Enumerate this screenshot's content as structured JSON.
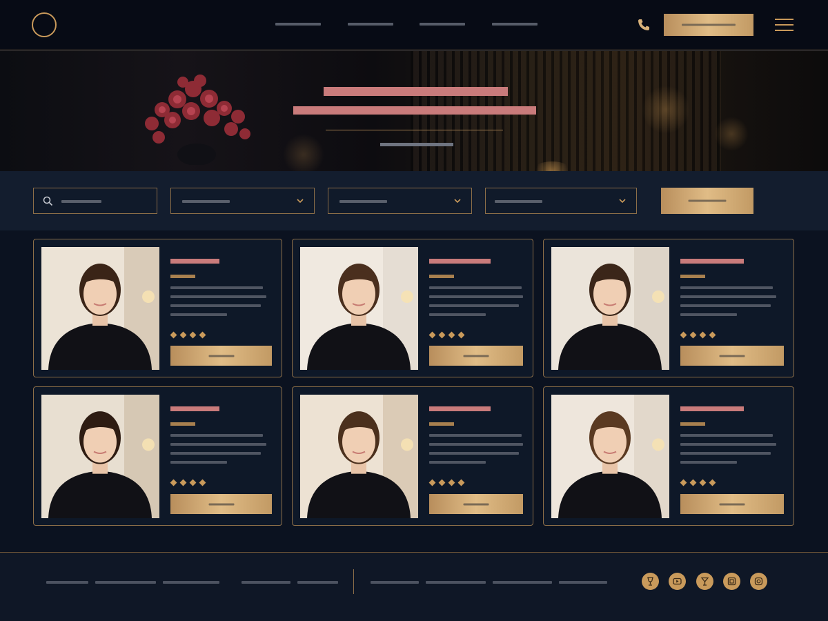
{
  "header": {
    "logo": "circle-logo",
    "nav_items": [
      "",
      "",
      "",
      ""
    ],
    "phone_icon": "phone-icon",
    "cta_label": "",
    "menu_icon": "hamburger-menu-icon"
  },
  "hero": {
    "title_line1": "",
    "title_line2": "",
    "subtitle": ""
  },
  "filters": {
    "search_placeholder": "",
    "dropdowns": [
      "",
      "",
      ""
    ],
    "search_button_label": ""
  },
  "cards": [
    {
      "name": "",
      "role": "",
      "rating": 4,
      "button_label": ""
    },
    {
      "name": "",
      "role": "",
      "rating": 4,
      "button_label": ""
    },
    {
      "name": "",
      "role": "",
      "rating": 4,
      "button_label": ""
    },
    {
      "name": "",
      "role": "",
      "rating": 4,
      "button_label": ""
    },
    {
      "name": "",
      "role": "",
      "rating": 4,
      "button_label": ""
    },
    {
      "name": "",
      "role": "",
      "rating": 4,
      "button_label": ""
    }
  ],
  "footer": {
    "links": [
      "",
      "",
      "",
      "",
      "",
      "",
      "",
      "",
      ""
    ],
    "social_icons": [
      "wine-glass-icon",
      "video-icon",
      "cocktail-icon",
      "gallery-icon",
      "instagram-icon"
    ]
  },
  "colors": {
    "background": "#0b1220",
    "accent_gold": "#c99a5b",
    "accent_rose": "#c97b7b",
    "panel": "#0e1828"
  }
}
